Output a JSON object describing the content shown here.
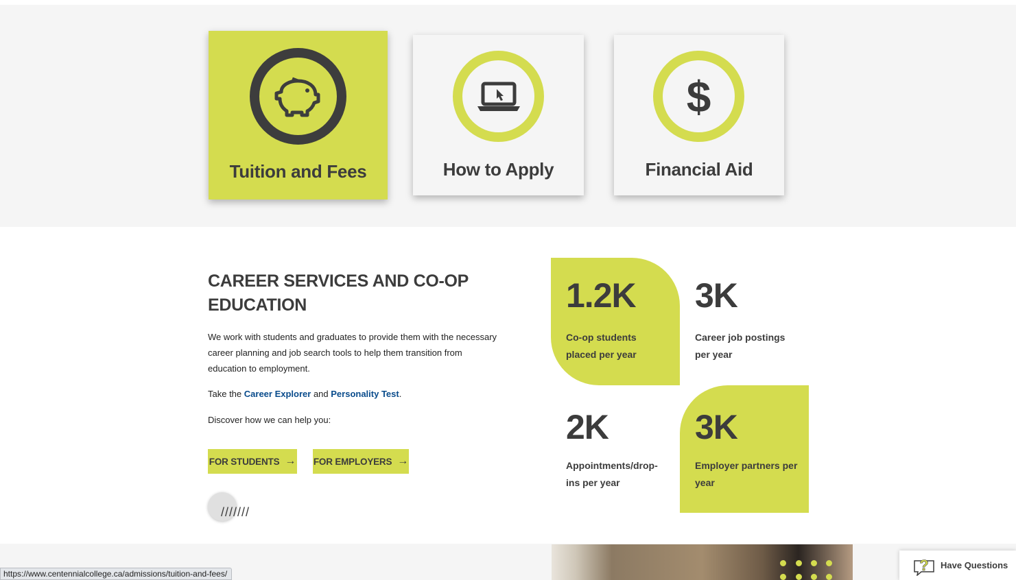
{
  "quick_links": [
    {
      "label": "Tuition and Fees",
      "icon": "piggy-bank-icon",
      "active": true
    },
    {
      "label": "How to Apply",
      "icon": "laptop-cursor-icon",
      "active": false
    },
    {
      "label": "Financial Aid",
      "icon": "dollar-icon",
      "active": false
    }
  ],
  "dollar_glyph": "$",
  "career": {
    "title": "CAREER SERVICES AND CO-OP EDUCATION",
    "body": "We work with students and graduates to provide them with the necessary career planning and job search tools to help them transition from education to employment.",
    "take_prefix": "Take the ",
    "career_explorer_link": "Career Explorer",
    "and_text": " and ",
    "personality_test_link": "Personality Test",
    "take_suffix": ".",
    "discover": "Discover how we can help you:",
    "buttons": {
      "students": "FOR STUDENTS",
      "employers": "FOR EMPLOYERS",
      "arrow": "→"
    },
    "slashes": "///////"
  },
  "stats": [
    {
      "value": "1.2K",
      "label": "Co-op students placed per year"
    },
    {
      "value": "3K",
      "label": "Career job postings per year"
    },
    {
      "value": "2K",
      "label": "Appointments/drop-ins per year"
    },
    {
      "value": "3K",
      "label": "Employer partners per year"
    }
  ],
  "status_bar": {
    "url": "https://www.centennialcollege.ca/admissions/tuition-and-fees/"
  },
  "help_widget": {
    "label": "Have Questions"
  },
  "colors": {
    "accent": "#d4dc4f",
    "text": "#3c3c3c",
    "link": "#0a4c8c",
    "panel": "#f5f5f5"
  }
}
